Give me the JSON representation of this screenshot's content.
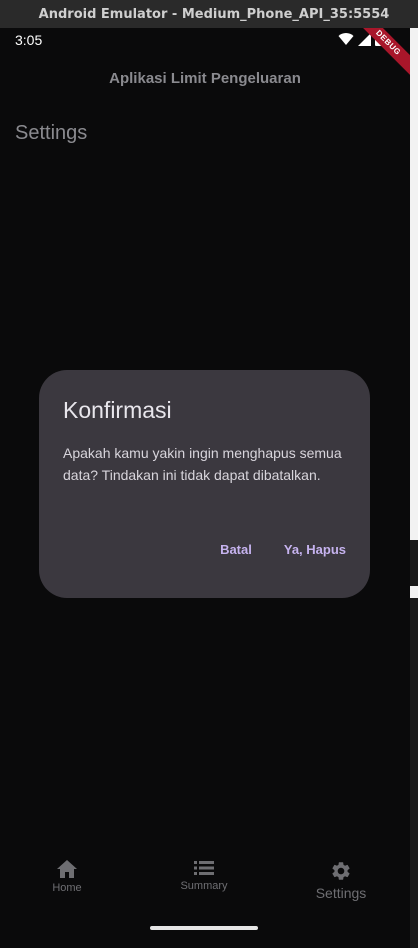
{
  "window": {
    "title": "Android Emulator - Medium_Phone_API_35:5554"
  },
  "status_bar": {
    "time": "3:05",
    "icons": [
      "wifi-icon",
      "signal-icon",
      "battery-icon"
    ]
  },
  "debug_banner": "DEBUG",
  "app_bar": {
    "title": "Aplikasi Limit Pengeluaran"
  },
  "page": {
    "heading": "Settings"
  },
  "dialog": {
    "title": "Konfirmasi",
    "message": "Apakah kamu yakin ingin menghapus semua data? Tindakan ini tidak dapat dibatalkan.",
    "cancel_label": "Batal",
    "confirm_label": "Ya, Hapus"
  },
  "bottom_nav": {
    "items": [
      {
        "label": "Home",
        "icon": "home-icon"
      },
      {
        "label": "Summary",
        "icon": "list-icon"
      },
      {
        "label": "Settings",
        "icon": "gear-icon",
        "active": true
      }
    ]
  },
  "colors": {
    "background": "#0a0a0b",
    "dialog_surface": "#3b383f",
    "accent": "#c6b3ef",
    "debug_banner": "#a8162a"
  }
}
